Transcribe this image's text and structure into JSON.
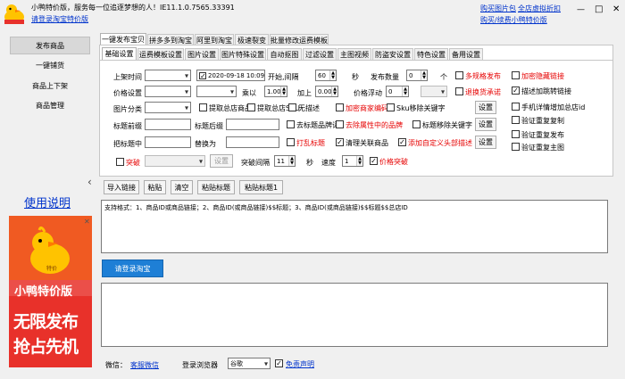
{
  "window": {
    "title": "小鸭特价版，服务每一位追逐梦想的人！IE11.1.0.7565.33391",
    "login_link": "请登录淘宝特价版",
    "top_links": [
      "购买图片包",
      "全店虚拟折扣",
      "购买/续费小鸭特价版"
    ],
    "controls": [
      "—",
      "□",
      "✕"
    ]
  },
  "sidebar": {
    "items": [
      {
        "label": "发布商品",
        "active": true
      },
      {
        "label": "一键铺货",
        "active": false
      },
      {
        "label": "商品上下架",
        "active": false
      },
      {
        "label": "商品管理",
        "active": false
      }
    ],
    "collapse_glyph": "‹",
    "help_link": "使用说明",
    "ad": {
      "badge": "特价",
      "product_name": "小鸭特价版",
      "slogan_line1": "无限发布",
      "slogan_line2": "抢占先机",
      "close": "✕"
    }
  },
  "main_tabs": [
    "一键发布宝贝",
    "拼多多到淘宝",
    "阿里到淘宝",
    "极速裂变",
    "批量修改运费模板"
  ],
  "sub_tabs": [
    "基础设置",
    "运费模板设置",
    "图片设置",
    "图片特殊设置",
    "自动抠图",
    "过滤设置",
    "主图视频",
    "防盗安设置",
    "特色设置",
    "备用设置"
  ],
  "form": {
    "up_time_label": "上架时间",
    "datetime_value": "2020-09-18 10:09:22",
    "start_interval_label": "开始,间隔",
    "interval_value": "60",
    "seconds_unit": "秒",
    "publish_count_label": "发布数量",
    "publish_count_value": "0",
    "count_unit": "个",
    "multi_spec": "多规格发布",
    "hide_link": "加密隐藏链接",
    "price_label": "价格设置",
    "multiply_label": "乘以",
    "multiply_value": "1.00",
    "add_label": "加上",
    "add_value": "0.00",
    "float_label": "价格浮动",
    "float_value": "0",
    "refund": "退换货承诺",
    "desc_link": "描述加跳转链接",
    "image_class_label": "图片分类",
    "extract_shop": "提取总店商品",
    "extract_sku": "提取总店SKU",
    "no_desc": "无描述",
    "encrypt_code": "加密商家编码",
    "sku_remove": "Sku移除关键字",
    "settings_btn": "设置",
    "mobile_detail": "手机详情增加总店id",
    "title_prefix_label": "标题前缀",
    "title_suffix_label": "标题后缀",
    "remove_brand": "去标题品牌词",
    "remove_attr_brand": "去除属性中的品牌",
    "title_remove_kw": "标题移除关键字",
    "verify_dup": "验证重复复制",
    "title_mid_label": "把标题中",
    "replace_label": "替换为",
    "disrupt_title": "打乱标题",
    "clean_related": "清理关联商品",
    "add_custom_desc": "添加自定义头部描述",
    "verify_dup_pub": "验证重复发布",
    "breakthrough": "突破",
    "set_btn_disabled": "设置",
    "break_interval_label": "突破间隔",
    "break_interval_value": "11",
    "speed_label": "速度",
    "speed_value": "1",
    "price_break": "价格突破",
    "verify_main_image": "验证重复主图"
  },
  "toolbar": {
    "import_link": "导入链接",
    "paste": "粘贴",
    "clear": "清空",
    "paste_title": "粘贴标题",
    "paste_title1": "粘贴标题1"
  },
  "input_area": {
    "hint": "支持格式：1、商品ID或商品链接；2、商品ID(或商品链接)$$标题；3、商品ID(或商品链接)$$标题$$总店ID"
  },
  "login_button": "请登录淘宝",
  "footer": {
    "wechat_label": "微信：",
    "service_link": "客服微信",
    "browser_label": "登录浏览器",
    "browser_value": "谷歌",
    "disclaimer": "免责声明"
  },
  "colors": {
    "link": "#0033cc",
    "red": "#e60000",
    "login_btn": "#1e7fd6",
    "ad_bg": "#e8312a",
    "ad_yellow": "#ffc300"
  }
}
